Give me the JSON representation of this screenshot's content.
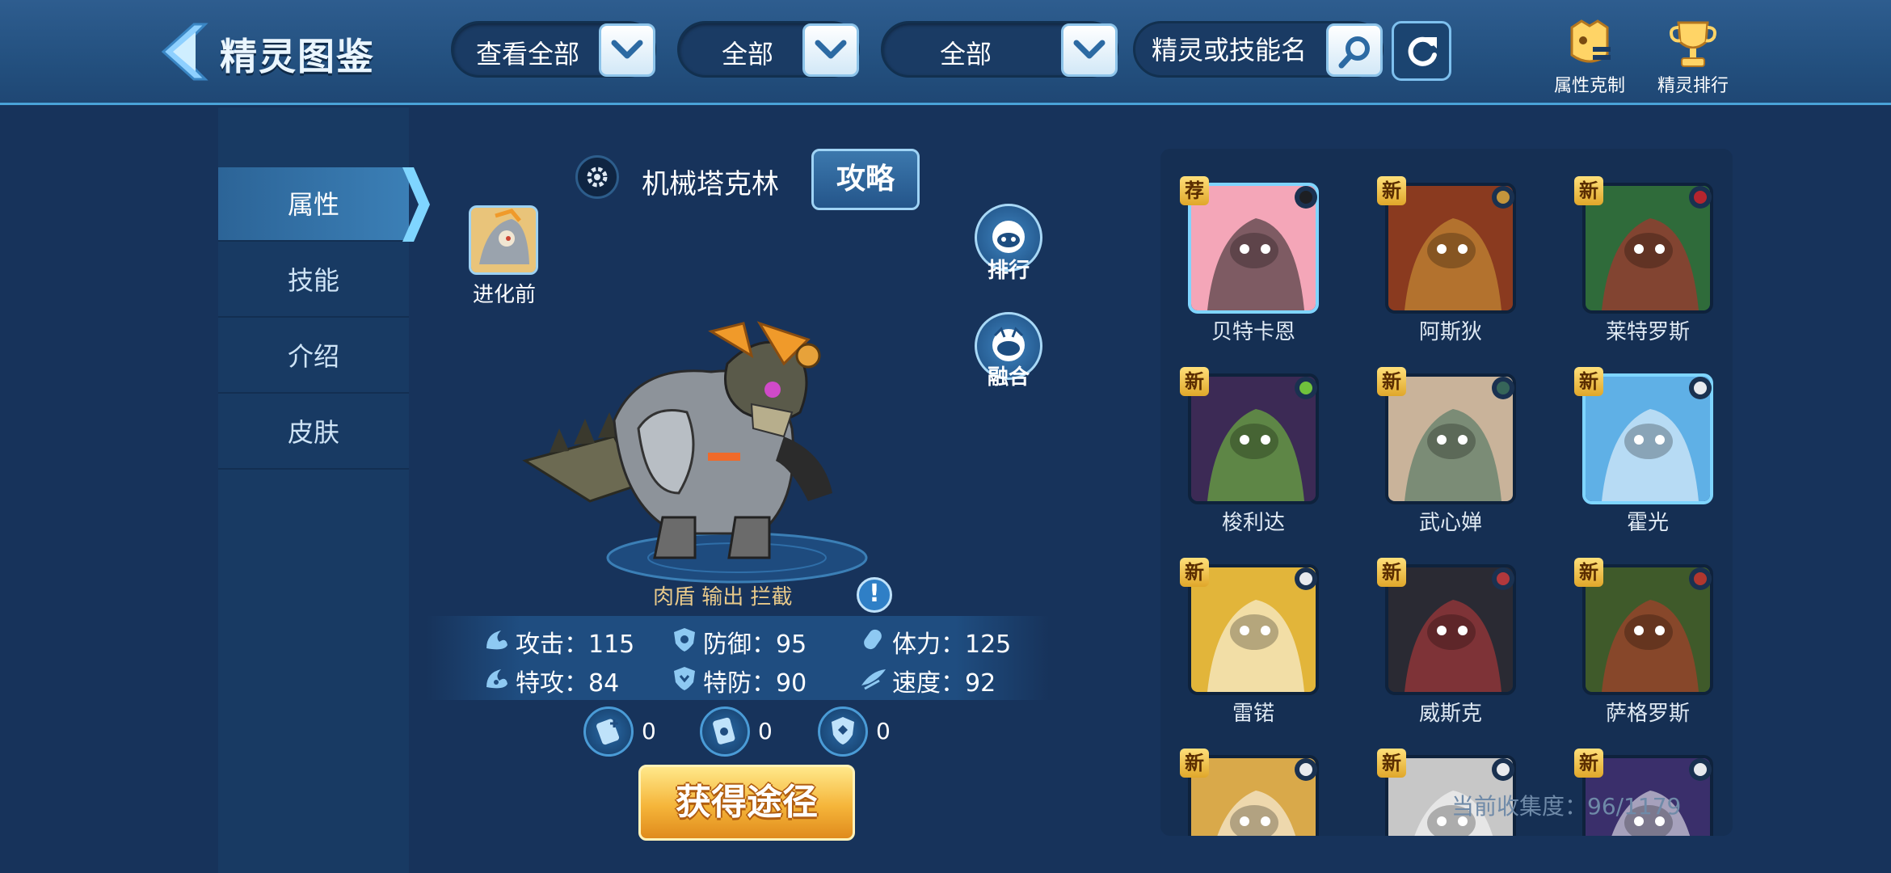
{
  "header": {
    "title": "精灵图鉴",
    "filters": [
      {
        "label": "查看全部"
      },
      {
        "label": "全部"
      },
      {
        "label": "全部"
      }
    ],
    "search_placeholder": "精灵或技能名",
    "attr_counter_label": "属性克制",
    "pet_ranking_label": "精灵排行"
  },
  "sidebar": {
    "items": [
      {
        "label": "属性",
        "active": true
      },
      {
        "label": "技能"
      },
      {
        "label": "介绍"
      },
      {
        "label": "皮肤"
      }
    ]
  },
  "detail": {
    "name": "机械塔克林",
    "guide_label": "攻略",
    "pre_evolution_label": "进化前",
    "rank_label": "排行",
    "fusion_label": "融合",
    "roles": "肉盾  输出  拦截",
    "stats": [
      {
        "label": "攻击：",
        "value": "115",
        "icon": "attack-icon"
      },
      {
        "label": "防御：",
        "value": "95",
        "icon": "defense-icon"
      },
      {
        "label": "体力：",
        "value": "125",
        "icon": "hp-icon"
      },
      {
        "label": "特攻：",
        "value": "84",
        "icon": "sp-attack-icon"
      },
      {
        "label": "特防：",
        "value": "90",
        "icon": "sp-defense-icon"
      },
      {
        "label": "速度：",
        "value": "92",
        "icon": "speed-icon"
      }
    ],
    "resources": [
      {
        "icon": "potion-icon",
        "value": "0"
      },
      {
        "icon": "card-icon",
        "value": "0"
      },
      {
        "icon": "shield-item-icon",
        "value": "0"
      }
    ],
    "obtain_label": "获得途径"
  },
  "grid": {
    "pets": [
      {
        "name": "贝特卡恩",
        "badge": "荐",
        "color": "#f4a6b8",
        "accent": "#1e1e1e"
      },
      {
        "name": "阿斯狄",
        "badge": "新",
        "color": "#8a3a1f",
        "accent": "#d6a13a"
      },
      {
        "name": "莱特罗斯",
        "badge": "新",
        "color": "#2f6b3a",
        "accent": "#c7252a"
      },
      {
        "name": "梭利达",
        "badge": "新",
        "color": "#3c2a55",
        "accent": "#7ad13a"
      },
      {
        "name": "武心婵",
        "badge": "新",
        "color": "#c9b39a",
        "accent": "#3a6b5a"
      },
      {
        "name": "霍光",
        "badge": "新",
        "color": "#5fb0e6",
        "accent": "#ffffff"
      },
      {
        "name": "雷锘",
        "badge": "新",
        "color": "#e2b53a",
        "accent": "#ffffff"
      },
      {
        "name": "威斯克",
        "badge": "新",
        "color": "#2a2a33",
        "accent": "#c23a3a"
      },
      {
        "name": "萨格罗斯",
        "badge": "新",
        "color": "#3f5a2a",
        "accent": "#c2392a"
      },
      {
        "name": "",
        "badge": "新",
        "color": "#d9a94a",
        "accent": "#ffffff"
      },
      {
        "name": "",
        "badge": "新",
        "color": "#c7c7c7",
        "accent": "#ffffff"
      },
      {
        "name": "",
        "badge": "新",
        "color": "#3a2f6b",
        "accent": "#ffffff"
      }
    ],
    "collection_label": "当前收集度：96/1179"
  },
  "colors": {
    "background": "#17335b",
    "topbar": "#23507f",
    "accent": "#7fd5ff",
    "gold": "#f5b53a"
  }
}
